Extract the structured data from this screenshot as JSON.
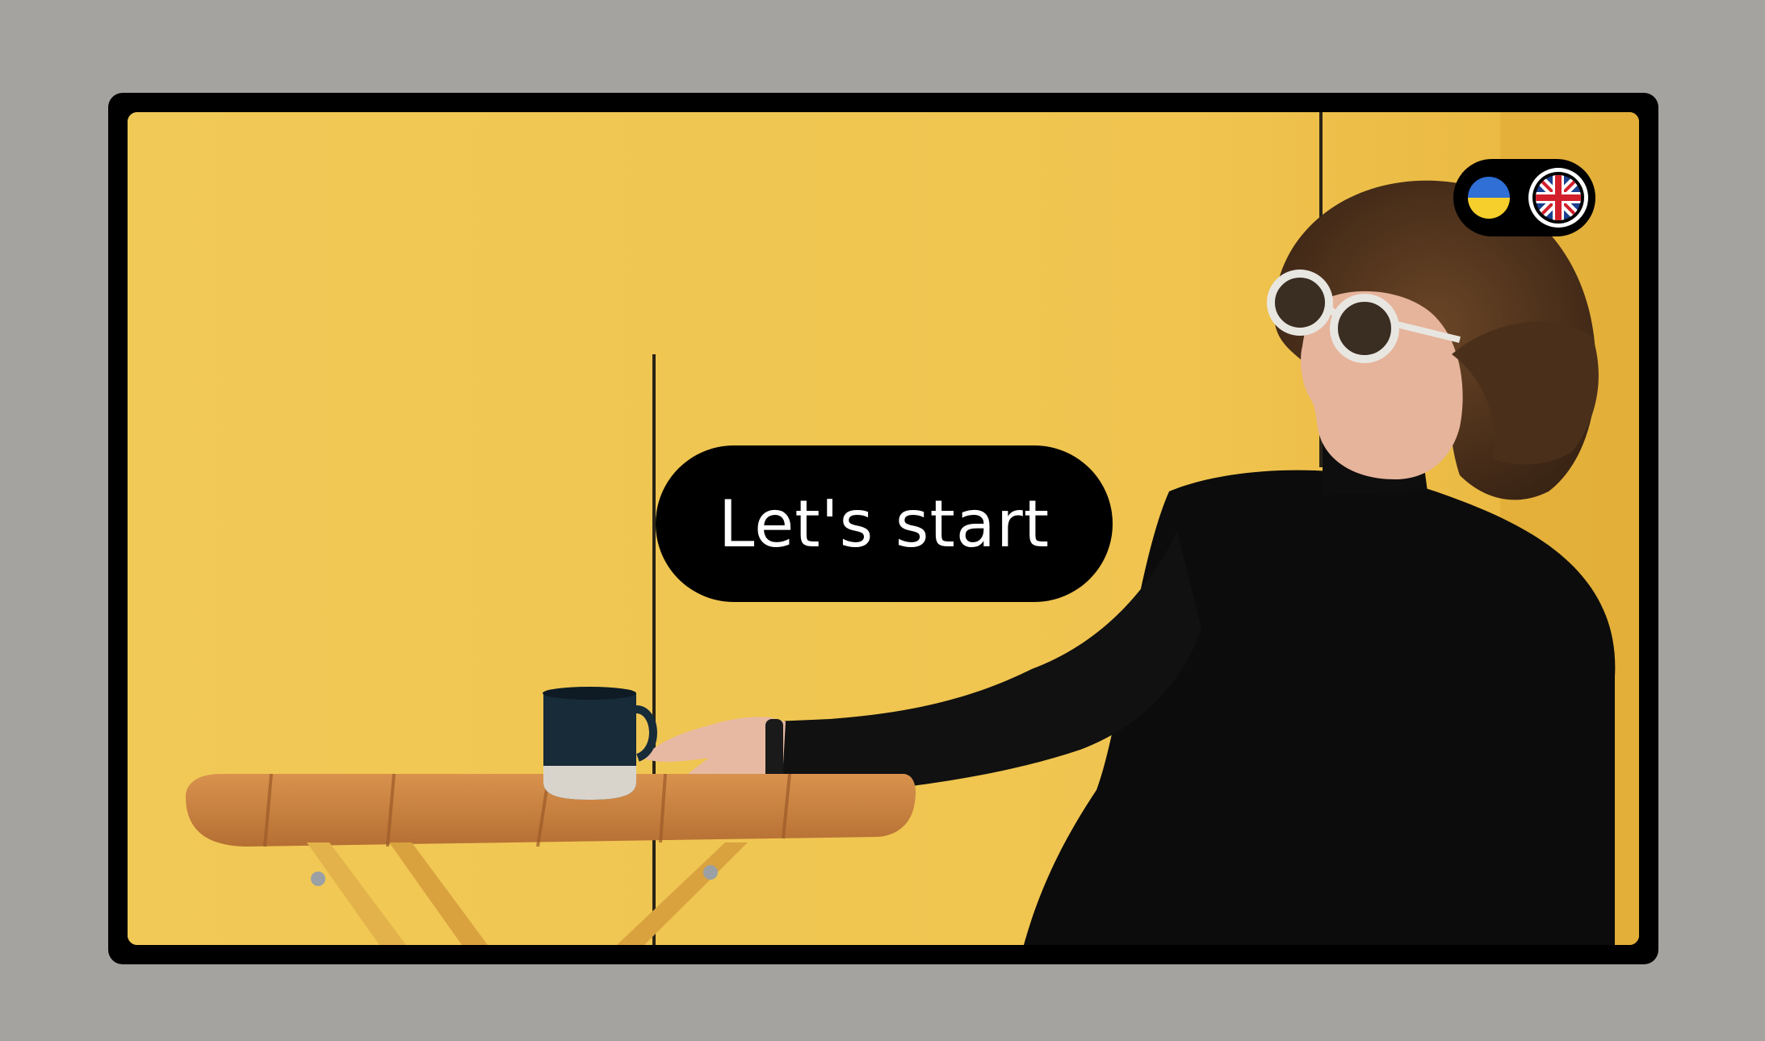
{
  "main": {
    "cta_label": "Let's start"
  },
  "language_switch": {
    "options": [
      {
        "code": "uk",
        "icon": "ukraine-flag-icon",
        "selected": false
      },
      {
        "code": "en",
        "icon": "uk-flag-icon",
        "selected": true
      }
    ]
  },
  "colors": {
    "page_background": "#a4a3a0",
    "frame": "#000000",
    "wall_yellow": "#f0c451",
    "button_background": "#000000",
    "button_text": "#ffffff",
    "flag_ua_blue": "#2f6fd6",
    "flag_ua_yellow": "#f6cf2c",
    "flag_uk_blue": "#1b3f8f",
    "flag_uk_red": "#d21f2b"
  }
}
